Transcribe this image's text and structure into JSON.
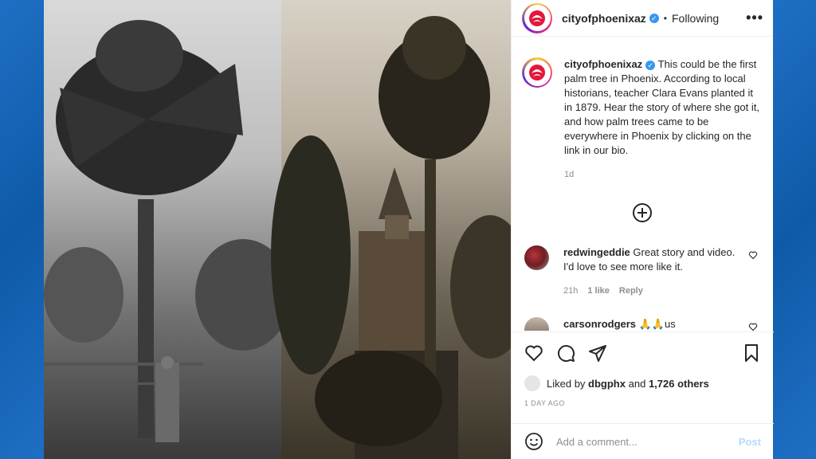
{
  "header": {
    "username": "cityofphoenixaz",
    "separator": "•",
    "follow_status": "Following",
    "more_label": "•••"
  },
  "caption": {
    "username": "cityofphoenixaz",
    "text": "This could be the first palm tree in Phoenix. According to local historians, teacher Clara Evans planted it in 1879. Hear the story of where she got it, and how palm trees came to be everywhere in Phoenix by clicking on the link in our bio.",
    "time": "1d"
  },
  "comments": [
    {
      "username": "redwingeddie",
      "text": "Great story and video. I'd love to see more like it.",
      "time": "21h",
      "likes": "1 like",
      "reply": "Reply"
    },
    {
      "username": "carsonrodgers",
      "text": "🙏🙏us",
      "time": "",
      "likes": "",
      "reply": ""
    }
  ],
  "likes": {
    "prefix": "Liked by",
    "user": "dbgphx",
    "conj": "and",
    "others": "1,726 others"
  },
  "post_date": "1 DAY AGO",
  "add_comment": {
    "placeholder": "Add a comment...",
    "post_label": "Post"
  },
  "colors": {
    "background": "#1565b8",
    "brand": "#ee2a7b",
    "verified": "#3897f0",
    "post_disabled": "#b3dbff"
  },
  "icons": [
    "heart-icon",
    "comment-icon",
    "share-icon",
    "bookmark-icon",
    "emoji-icon",
    "plus-circle-icon",
    "more-icon"
  ]
}
